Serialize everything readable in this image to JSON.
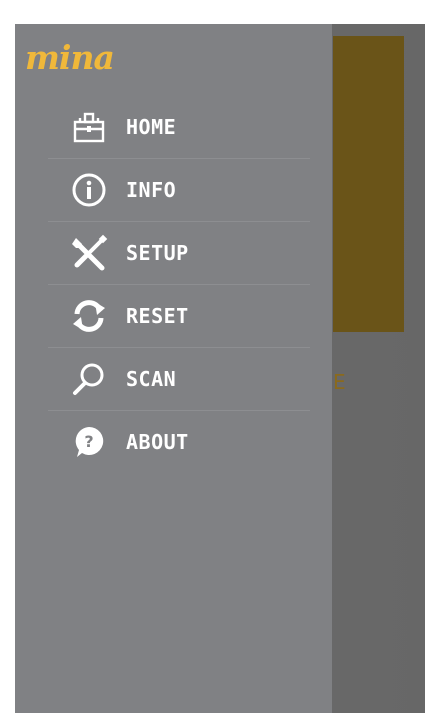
{
  "app": {
    "logo_text": "mina"
  },
  "colors": {
    "drawer_bg": "#808184",
    "logo": "#f0b83a",
    "menu_text": "#ffffff",
    "accent_block": "#6a5418"
  },
  "menu": {
    "items": [
      {
        "label": "HOME",
        "icon": "home-icon"
      },
      {
        "label": "INFO",
        "icon": "info-icon"
      },
      {
        "label": "SETUP",
        "icon": "tools-icon"
      },
      {
        "label": "RESET",
        "icon": "reset-icon"
      },
      {
        "label": "SCAN",
        "icon": "search-icon"
      },
      {
        "label": "ABOUT",
        "icon": "help-icon"
      }
    ]
  },
  "background_peek": {
    "glyph": "E"
  }
}
